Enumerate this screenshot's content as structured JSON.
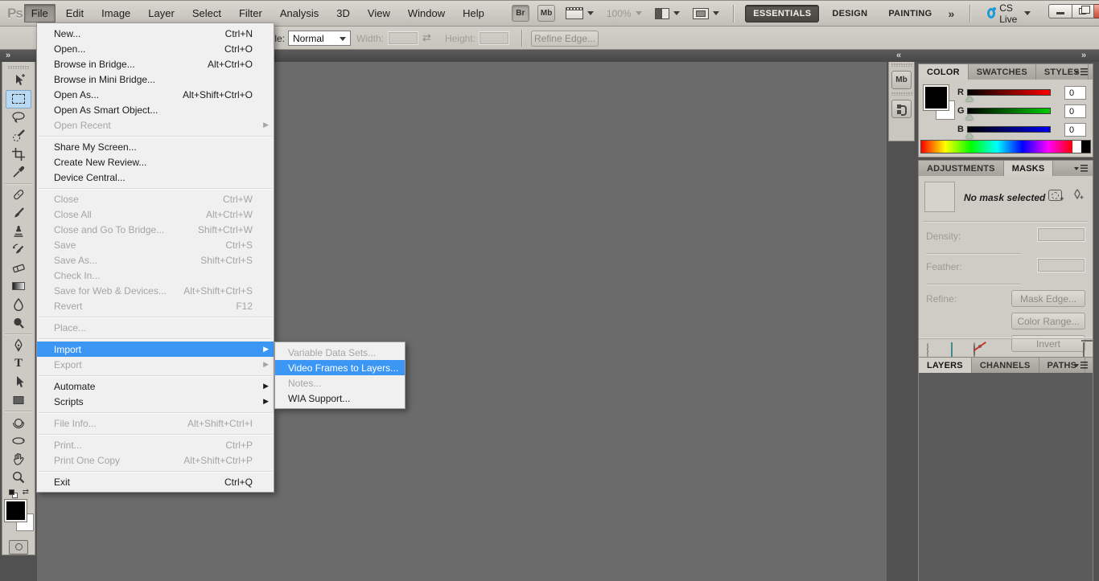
{
  "titlebar": {
    "logo": "Ps",
    "menus": [
      "File",
      "Edit",
      "Image",
      "Layer",
      "Select",
      "Filter",
      "Analysis",
      "3D",
      "View",
      "Window",
      "Help"
    ],
    "active_menu": "File",
    "bridge_button": "Br",
    "mini_bridge_button": "Mb",
    "zoom_level": "100%",
    "workspaces": [
      "ESSENTIALS",
      "DESIGN",
      "PAINTING"
    ],
    "active_workspace": "ESSENTIALS",
    "workspace_overflow": "»",
    "cs_live_label": "CS Live"
  },
  "options_bar": {
    "style_label": "Style:",
    "style_value": "Normal",
    "width_label": "Width:",
    "width_value": "",
    "height_label": "Height:",
    "height_value": "",
    "refine_edge_button": "Refine Edge..."
  },
  "file_menu": {
    "items": [
      {
        "label": "New...",
        "shortcut": "Ctrl+N"
      },
      {
        "label": "Open...",
        "shortcut": "Ctrl+O"
      },
      {
        "label": "Browse in Bridge...",
        "shortcut": "Alt+Ctrl+O"
      },
      {
        "label": "Browse in Mini Bridge..."
      },
      {
        "label": "Open As...",
        "shortcut": "Alt+Shift+Ctrl+O"
      },
      {
        "label": "Open As Smart Object..."
      },
      {
        "label": "Open Recent",
        "disabled": true,
        "submenu": true
      },
      {
        "separator": true
      },
      {
        "label": "Share My Screen..."
      },
      {
        "label": "Create New Review..."
      },
      {
        "label": "Device Central..."
      },
      {
        "separator": true
      },
      {
        "label": "Close",
        "shortcut": "Ctrl+W",
        "disabled": true
      },
      {
        "label": "Close All",
        "shortcut": "Alt+Ctrl+W",
        "disabled": true
      },
      {
        "label": "Close and Go To Bridge...",
        "shortcut": "Shift+Ctrl+W",
        "disabled": true
      },
      {
        "label": "Save",
        "shortcut": "Ctrl+S",
        "disabled": true
      },
      {
        "label": "Save As...",
        "shortcut": "Shift+Ctrl+S",
        "disabled": true
      },
      {
        "label": "Check In...",
        "disabled": true
      },
      {
        "label": "Save for Web & Devices...",
        "shortcut": "Alt+Shift+Ctrl+S",
        "disabled": true
      },
      {
        "label": "Revert",
        "shortcut": "F12",
        "disabled": true
      },
      {
        "separator": true
      },
      {
        "label": "Place...",
        "disabled": true
      },
      {
        "separator": true
      },
      {
        "label": "Import",
        "submenu": true,
        "highlighted": true
      },
      {
        "label": "Export",
        "submenu": true,
        "disabled": true
      },
      {
        "separator": true
      },
      {
        "label": "Automate",
        "submenu": true
      },
      {
        "label": "Scripts",
        "submenu": true
      },
      {
        "separator": true
      },
      {
        "label": "File Info...",
        "shortcut": "Alt+Shift+Ctrl+I",
        "disabled": true
      },
      {
        "separator": true
      },
      {
        "label": "Print...",
        "shortcut": "Ctrl+P",
        "disabled": true
      },
      {
        "label": "Print One Copy",
        "shortcut": "Alt+Shift+Ctrl+P",
        "disabled": true
      },
      {
        "separator": true
      },
      {
        "label": "Exit",
        "shortcut": "Ctrl+Q"
      }
    ]
  },
  "import_submenu": {
    "items": [
      {
        "label": "Variable Data Sets...",
        "disabled": true
      },
      {
        "label": "Video Frames to Layers...",
        "highlighted": true
      },
      {
        "label": "Notes...",
        "disabled": true
      },
      {
        "label": "WIA Support..."
      }
    ]
  },
  "toolbox": {
    "tools": [
      "move",
      "rectangular-marquee",
      "lasso",
      "quick-selection",
      "crop",
      "eyedropper",
      "spot-healing-brush",
      "brush",
      "clone-stamp",
      "history-brush",
      "eraser",
      "gradient",
      "blur",
      "dodge",
      "pen",
      "type",
      "path-selection",
      "rectangle-shape",
      "3d-object-rotate",
      "3d-orbit",
      "hand",
      "zoom"
    ],
    "selected_tool": "rectangular-marquee"
  },
  "icon_dock": {
    "mini_bridge_label": "Mb"
  },
  "color_panel": {
    "tabs": [
      "COLOR",
      "SWATCHES",
      "STYLES"
    ],
    "active_tab": "COLOR",
    "channels": [
      {
        "label": "R",
        "value": "0"
      },
      {
        "label": "G",
        "value": "0"
      },
      {
        "label": "B",
        "value": "0"
      }
    ],
    "foreground_color": "#000000",
    "background_color": "#ffffff"
  },
  "masks_panel": {
    "tabs": [
      "ADJUSTMENTS",
      "MASKS"
    ],
    "active_tab": "MASKS",
    "status_text": "No mask selected",
    "density_label": "Density:",
    "feather_label": "Feather:",
    "refine_label": "Refine:",
    "buttons": [
      "Mask Edge...",
      "Color Range...",
      "Invert"
    ]
  },
  "layers_panel": {
    "tabs": [
      "LAYERS",
      "CHANNELS",
      "PATHS"
    ],
    "active_tab": "LAYERS"
  },
  "colors": {
    "menu_highlight": "#3b97f3",
    "chrome_light": "#cdcac4",
    "app_background": "#515151",
    "canvas_background": "#6b6b6b",
    "close_button_red": "#d96a57"
  }
}
